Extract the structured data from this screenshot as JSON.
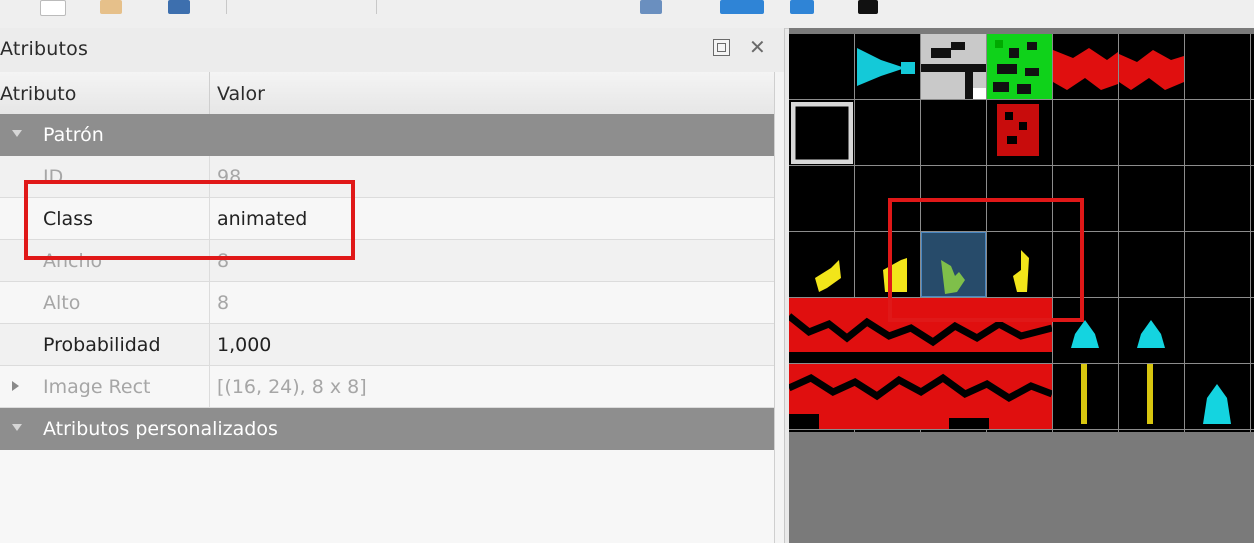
{
  "panel": {
    "title": "Atributos",
    "columns": {
      "attribute": "Atributo",
      "value": "Valor"
    },
    "groups": {
      "pattern": "Patrón",
      "custom": "Atributos personalizados"
    },
    "rows": {
      "id": {
        "label": "ID",
        "value": "98"
      },
      "class": {
        "label": "Class",
        "value": "animated"
      },
      "width": {
        "label": "Ancho",
        "value": "8"
      },
      "height": {
        "label": "Alto",
        "value": "8"
      },
      "probability": {
        "label": "Probabilidad",
        "value": "1,000"
      },
      "image_rect": {
        "label": "Image Rect",
        "value": "[(16, 24), 8 x 8]"
      }
    }
  },
  "icons": {
    "float": "float-panel-icon",
    "close": "close-panel-icon",
    "expand": "expand-arrow-icon"
  },
  "colors": {
    "highlight": "#e01818",
    "group_bg": "#8e8e8e",
    "selection": "#274b6a"
  }
}
